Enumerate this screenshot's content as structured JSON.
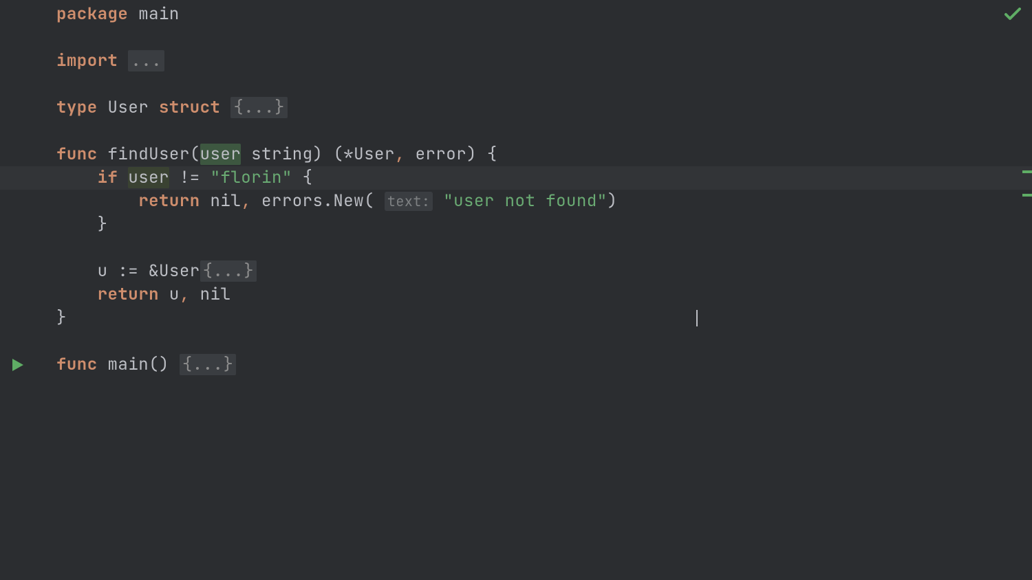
{
  "colors": {
    "background": "#2b2d30",
    "keyword": "#cf8e6d",
    "string": "#6aab73",
    "foreground": "#bcbec4",
    "foldedBg": "#3a3d41",
    "accentGreen": "#5fad65"
  },
  "status": {
    "analysisOk": true
  },
  "gutter": {
    "runLine": 15
  },
  "cursor": {
    "lineIndex": 13,
    "colPx": 930
  },
  "highlightLineIndex": 7,
  "markers": [
    {
      "topPx": 248
    },
    {
      "topPx": 282
    }
  ],
  "code": {
    "l0": {
      "kw": "package",
      "sp": " ",
      "name": "main"
    },
    "l2": {
      "kw": "import",
      "sp": " ",
      "fold": "..."
    },
    "l4": {
      "kw1": "type",
      "sp1": " ",
      "name": "User",
      "sp2": " ",
      "kw2": "struct",
      "sp3": " ",
      "fold": "{...}"
    },
    "l6": {
      "kw": "func",
      "sp": " ",
      "fname": "findUser",
      "lp": "(",
      "param": "user",
      "sp2": " ",
      "ptype": "string",
      "rp": ")",
      "sp3": " ",
      "lret": "(*",
      "rtype": "User",
      "comma": ",",
      "sp4": " ",
      "err": "error",
      "rret": ")",
      "sp5": " ",
      "brace": "{"
    },
    "l7": {
      "indent": "    ",
      "kw": "if",
      "sp": " ",
      "var": "user",
      "sp2": " ",
      "op": "!=",
      "sp3": " ",
      "str": "\"florin\"",
      "sp4": " ",
      "brace": "{"
    },
    "l8": {
      "indent": "        ",
      "kw": "return",
      "sp": " ",
      "nil": "nil",
      "comma": ",",
      "sp2": " ",
      "errs": "errors.New(",
      "hintsp": " ",
      "hint": "text:",
      "hintsp2": " ",
      "str": "\"user not found\"",
      "rp": ")"
    },
    "l9": {
      "indent": "    ",
      "brace": "}"
    },
    "l11": {
      "indent": "    ",
      "lhs": "u := &",
      "type": "User",
      "fold": "{...}"
    },
    "l12": {
      "indent": "    ",
      "kw": "return",
      "sp": " ",
      "var": "u",
      "comma": ",",
      "sp2": " ",
      "nil": "nil"
    },
    "l13": {
      "brace": "}"
    },
    "l15": {
      "kw": "func",
      "sp": " ",
      "fname": "main",
      "parens": "()",
      "sp2": " ",
      "fold": "{...}"
    }
  }
}
